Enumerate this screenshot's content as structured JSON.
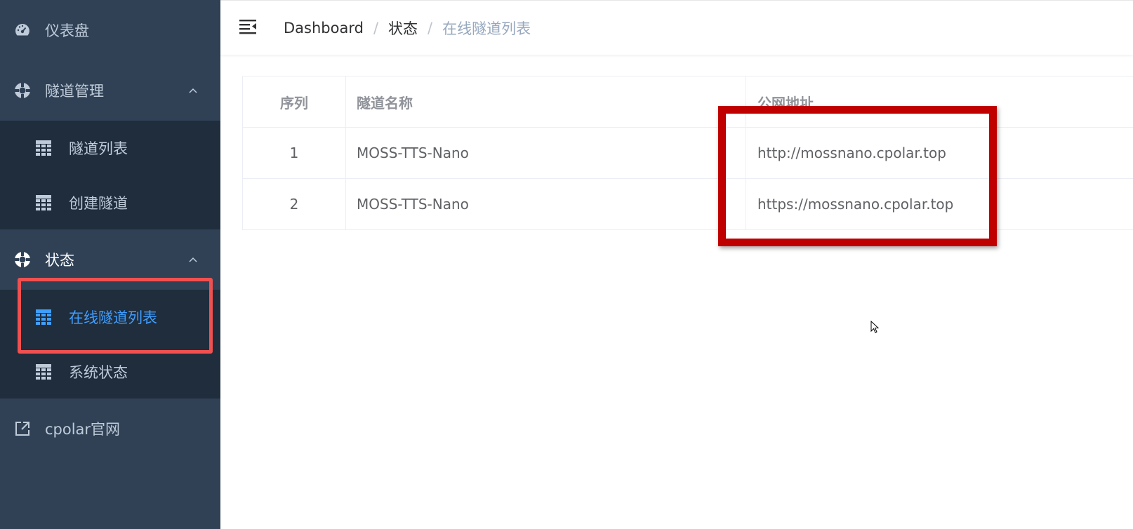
{
  "sidebar": {
    "items": [
      {
        "label": "仪表盘",
        "icon": "dashboard-icon"
      },
      {
        "label": "隧道管理",
        "icon": "tunnel-manage-icon",
        "expanded": true,
        "children": [
          {
            "label": "隧道列表",
            "icon": "grid-icon"
          },
          {
            "label": "创建隧道",
            "icon": "grid-icon"
          }
        ]
      },
      {
        "label": "状态",
        "icon": "status-icon",
        "expanded": true,
        "children": [
          {
            "label": "在线隧道列表",
            "icon": "grid-icon",
            "active": true
          },
          {
            "label": "系统状态",
            "icon": "grid-icon"
          }
        ]
      },
      {
        "label": "cpolar官网",
        "icon": "external-link-icon"
      }
    ]
  },
  "header": {
    "breadcrumb": [
      "Dashboard",
      "状态",
      "在线隧道列表"
    ]
  },
  "table": {
    "columns": [
      "序列",
      "隧道名称",
      "公网地址"
    ],
    "rows": [
      {
        "index": "1",
        "name": "MOSS-TTS-Nano",
        "url": "http://mossnano.cpolar.top"
      },
      {
        "index": "2",
        "name": "MOSS-TTS-Nano",
        "url": "https://mossnano.cpolar.top"
      }
    ]
  },
  "colors": {
    "sidebar_bg": "#304156",
    "submenu_bg": "#1f2d3d",
    "active": "#409eff",
    "highlight_sidebar": "#f05050",
    "highlight_main": "#c00000"
  }
}
